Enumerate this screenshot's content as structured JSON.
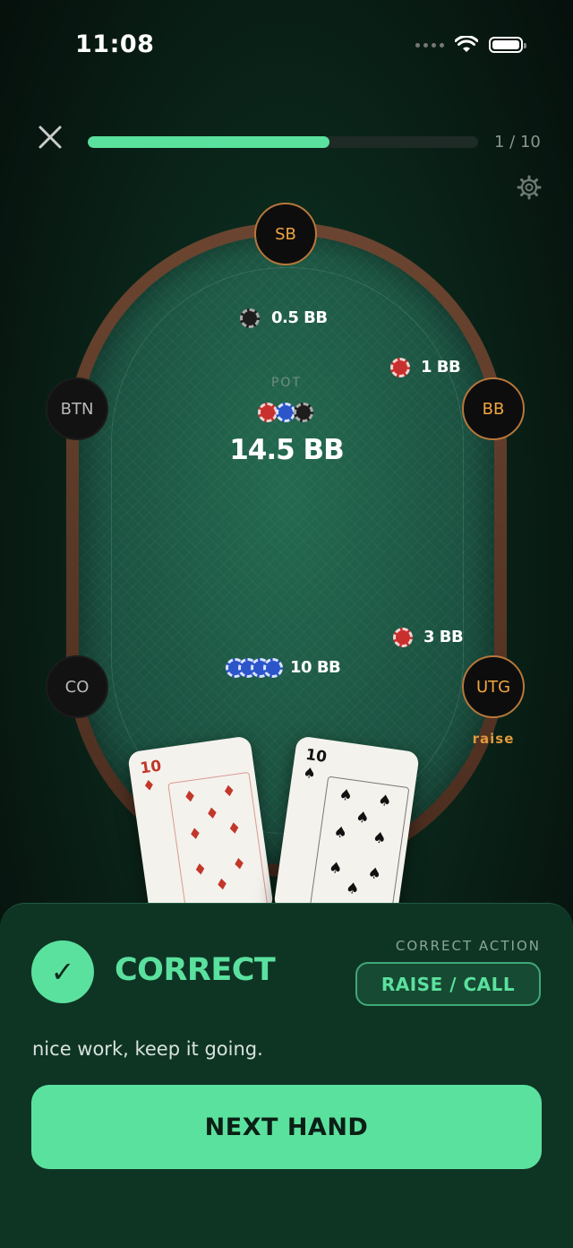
{
  "status_bar": {
    "time": "11:08"
  },
  "header": {
    "progress_text": "1 / 10",
    "progress_fraction": 0.62
  },
  "table": {
    "seats": [
      {
        "label": "SB",
        "state": "active"
      },
      {
        "label": "BB",
        "state": "active"
      },
      {
        "label": "UTG",
        "state": "active",
        "action": "raise"
      },
      {
        "label": "CO",
        "state": "idle"
      },
      {
        "label": "BTN",
        "state": "idle"
      }
    ],
    "bets": {
      "sb": "0.5 BB",
      "bb": "1 BB",
      "utg": "3 BB",
      "hero": "10 BB"
    },
    "pot": {
      "label": "POT",
      "amount": "14.5 BB"
    }
  },
  "hand": [
    {
      "rank": "10",
      "suit": "♦",
      "color": "#c2372a"
    },
    {
      "rank": "10",
      "suit": "♠",
      "color": "#111111"
    }
  ],
  "result": {
    "title": "CORRECT",
    "check_glyph": "✓",
    "correct_action_label": "CORRECT ACTION",
    "correct_action": "RAISE / CALL",
    "feedback": "nice work, keep it going.",
    "next_button": "NEXT HAND"
  },
  "colors": {
    "accent": "#5be19e",
    "felt": "#1f5a44",
    "rail": "#5a3827",
    "seat_active_text": "#f0a640"
  }
}
